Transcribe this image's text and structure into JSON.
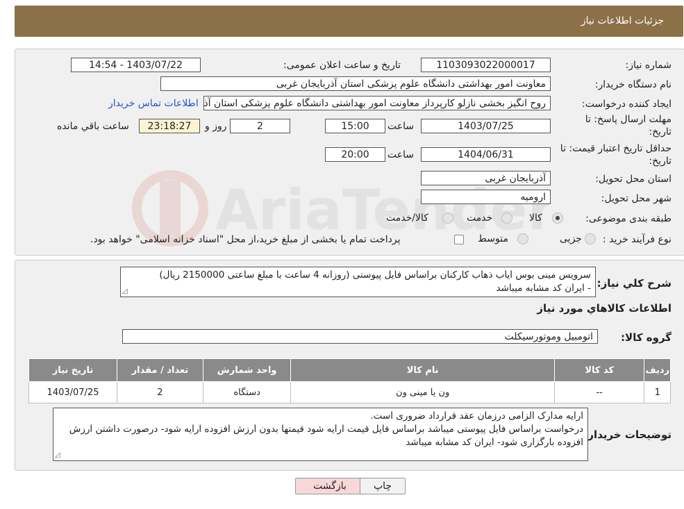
{
  "header": {
    "title": "جزئیات اطلاعات نیاز"
  },
  "form": {
    "need_number_label": "شماره نیاز:",
    "need_number": "1103093022000017",
    "announce_label": "تاریخ و ساعت اعلان عمومی:",
    "announce_value": "1403/07/22 - 14:54",
    "buyer_org_label": "نام دستگاه خریدار:",
    "buyer_org": "معاونت امور بهداشتی دانشگاه علوم پزشکی استان آذربایجان غربی",
    "creator_label": "ایجاد کننده درخواست:",
    "creator": "روح انگیز بخشی نازلو کارپرداز معاونت امور بهداشتی دانشگاه علوم پزشکی استان آذربایجان غربی",
    "contact_link": "اطلاعات تماس خریدار",
    "deadline_label_1": "مهلت ارسال پاسخ: تا",
    "deadline_label_2": "تاریخ:",
    "deadline_date": "1403/07/25",
    "time_label": "ساعت",
    "deadline_time": "15:00",
    "days_value": "2",
    "days_label": "روز و",
    "remaining_time": "23:18:27",
    "remaining_label": "ساعت باقي مانده",
    "validity_label_1": "حداقل تاريخ اعتبار قيمت: تا",
    "validity_label_2": "تاريخ:",
    "validity_date": "1404/06/31",
    "validity_time": "20:00",
    "province_label": "استان محل تحویل:",
    "province": "آذربایجان غربی",
    "city_label": "شهر محل تحویل:",
    "city": "ارومیه",
    "category_label": "طبقه بندی موضوعی:",
    "category_options": [
      "کالا",
      "خدمت",
      "کالا/خدمت"
    ],
    "process_label": "نوع فرآیند خرید :",
    "process_options": [
      "جزیی",
      "متوسط"
    ],
    "payment_note": "پرداخت تمام یا بخشی از مبلغ خرید،از محل \"اسناد خزانه اسلامی\" خواهد بود."
  },
  "details": {
    "description_label": "شرح کلي نياز:",
    "description": "سرویس مینی بوس ایاب ذهاب کارکنان براساس فایل پیوستی (روزانه 4 ساعت با مبلغ ساعتی 2150000 ریال)\n- ایران کد مشابه میباشد",
    "goods_info_title": "اطلاعات کالاهاي مورد نياز",
    "goods_group_label": "گروه کالا:",
    "goods_group": "اتومبیل وموتورسیکلت",
    "table": {
      "headers": [
        "رديف",
        "کد کالا",
        "نام کالا",
        "واحد شمارش",
        "تعداد / مقدار",
        "تاریخ نیاز"
      ],
      "rows": [
        [
          "1",
          "--",
          "ون یا مینی ون",
          "دستگاه",
          "2",
          "1403/07/25"
        ]
      ]
    },
    "buyer_notes_label": "توضیحات خریدار:",
    "buyer_notes": "ارایه مدارک الزامی درزمان عقد قرارداد ضروری است.\nدرخواست براساس فایل پیوستی میباشد براساس فایل قیمت ارایه شود قیمتها بدون ارزش افزوده ارایه شود- درصورت داشتن ارزش افزوده بارگزاری شود- ایران کد مشابه میباشد"
  },
  "buttons": {
    "print": "چاپ",
    "back": "بازگشت"
  },
  "colors": {
    "header": "#8c7048",
    "back_button": "#f7d7d7",
    "link": "#2255cc"
  }
}
